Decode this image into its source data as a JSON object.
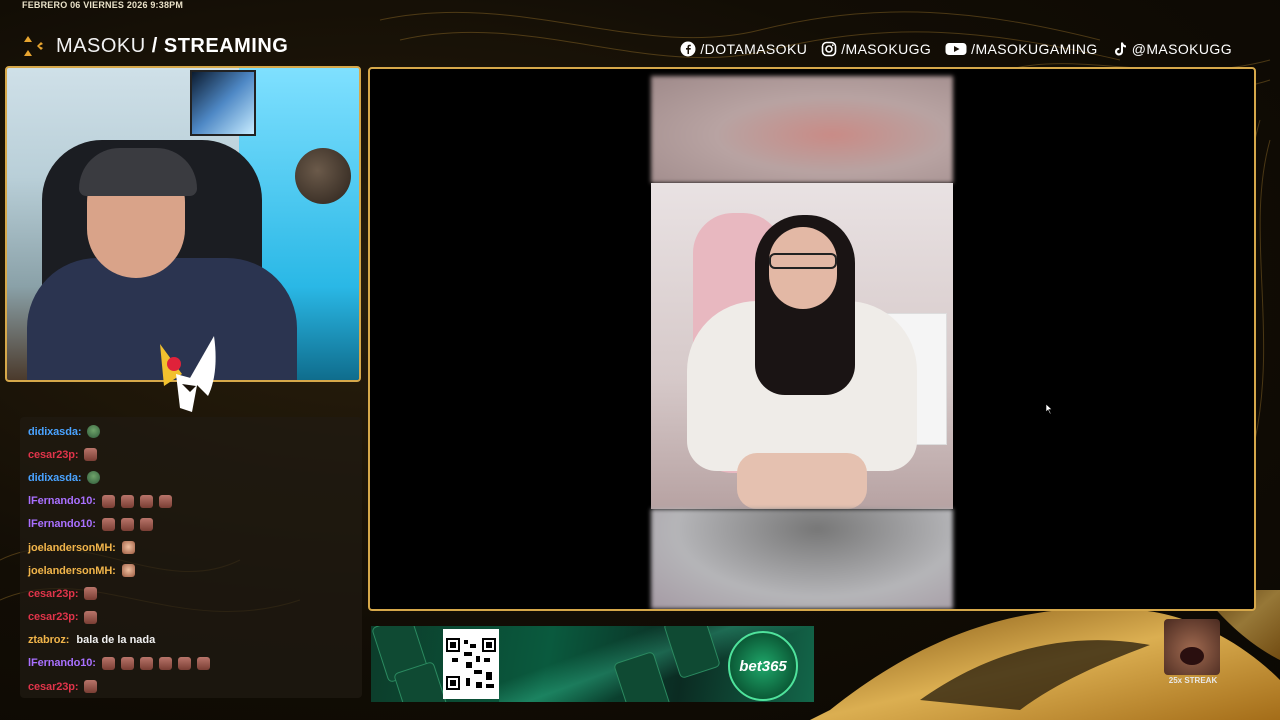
{
  "header": {
    "datetime": "FEBRERO 06 VIERNES 2026 9:38PM",
    "brand_name": "MASOKU",
    "brand_separator": " / ",
    "brand_suffix": "STREAMING"
  },
  "socials": [
    {
      "icon": "facebook-icon",
      "handle": "/DOTAMASOKU"
    },
    {
      "icon": "instagram-icon",
      "handle": "/MASOKUGG"
    },
    {
      "icon": "youtube-icon",
      "handle": "/MASOKUGAMING"
    },
    {
      "icon": "tiktok-icon",
      "handle": "@MASOKUGG"
    }
  ],
  "chat": {
    "messages": [
      {
        "user": "didixasda:",
        "color": "#4aa3ff",
        "text": "",
        "emotes": [
          "pepe"
        ]
      },
      {
        "user": "cesar23p:",
        "color": "#e0344a",
        "text": "",
        "emotes": [
          "em"
        ]
      },
      {
        "user": "didixasda:",
        "color": "#4aa3ff",
        "text": "",
        "emotes": [
          "pepe"
        ]
      },
      {
        "user": "lFernando10:",
        "color": "#a970ff",
        "text": "",
        "emotes": [
          "em",
          "em",
          "em",
          "em"
        ]
      },
      {
        "user": "lFernando10:",
        "color": "#a970ff",
        "text": "",
        "emotes": [
          "em",
          "em",
          "em"
        ]
      },
      {
        "user": "joelandersonMH:",
        "color": "#f0b44a",
        "text": "",
        "emotes": [
          "face"
        ]
      },
      {
        "user": "joelandersonMH:",
        "color": "#f0b44a",
        "text": "",
        "emotes": [
          "face"
        ]
      },
      {
        "user": "cesar23p:",
        "color": "#e0344a",
        "text": "",
        "emotes": [
          "em"
        ]
      },
      {
        "user": "cesar23p:",
        "color": "#e0344a",
        "text": "",
        "emotes": [
          "em"
        ]
      },
      {
        "user": "ztabroz:",
        "color": "#f0b44a",
        "text": "bala de la nada",
        "emotes": []
      },
      {
        "user": "lFernando10:",
        "color": "#a970ff",
        "text": "",
        "emotes": [
          "em",
          "em",
          "em",
          "em",
          "em",
          "em"
        ]
      },
      {
        "user": "cesar23p:",
        "color": "#e0344a",
        "text": "",
        "emotes": [
          "em"
        ]
      }
    ]
  },
  "sponsor": {
    "brand": "bet365"
  },
  "streak": {
    "label": "25x STREAK"
  },
  "colors": {
    "accent_gold": "#d6a84a",
    "background": "#120d05"
  }
}
